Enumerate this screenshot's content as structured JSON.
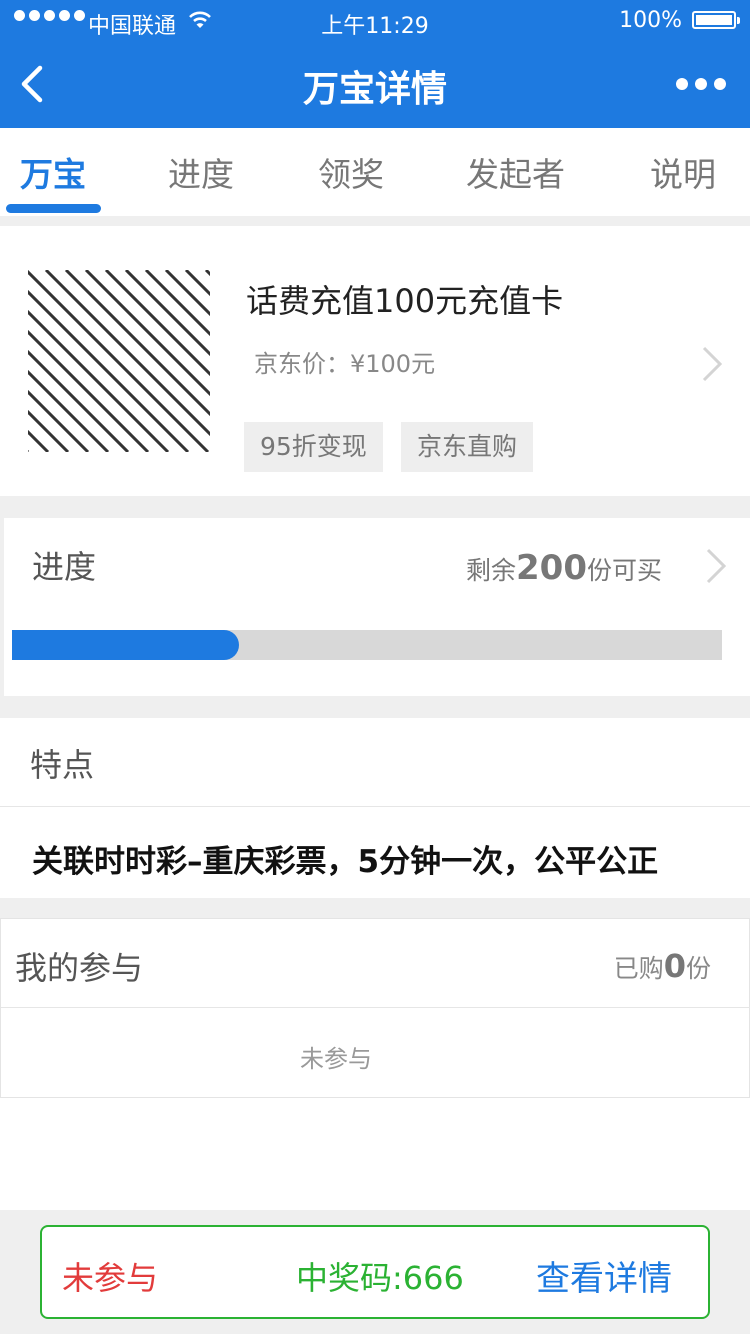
{
  "status_bar": {
    "carrier": "中国联通",
    "time": "上午11:29",
    "battery": "100%"
  },
  "nav": {
    "title": "万宝详情",
    "back_icon": "back-arrow-icon",
    "more_icon": "more-dots-icon"
  },
  "tabs": [
    "万宝",
    "进度",
    "领奖",
    "发起者",
    "说明"
  ],
  "active_tab": "万宝",
  "product": {
    "name": "话费充值100元充值卡",
    "price": "京东价：¥100元",
    "tags": [
      "95折变现",
      "京东直购"
    ]
  },
  "progress": {
    "title": "进度",
    "remaining_prefix": "剩余",
    "remaining_count": "200",
    "remaining_suffix": "份可买",
    "fraction": 0.32
  },
  "features": {
    "title": "特点",
    "text": "关联时时彩–重庆彩票，5分钟一次，公平公正"
  },
  "participation": {
    "title": "我的参与",
    "bought_prefix": "已购",
    "bought_count": "0",
    "bought_suffix": "份",
    "empty_text": "未参与"
  },
  "bottom_bar": {
    "status": "未参与",
    "winning_code": "中奖码:666",
    "detail_button": "查看详情"
  },
  "colors": {
    "primary": "#1e7ae0",
    "green": "#2bb233",
    "red": "#e23b3b"
  }
}
